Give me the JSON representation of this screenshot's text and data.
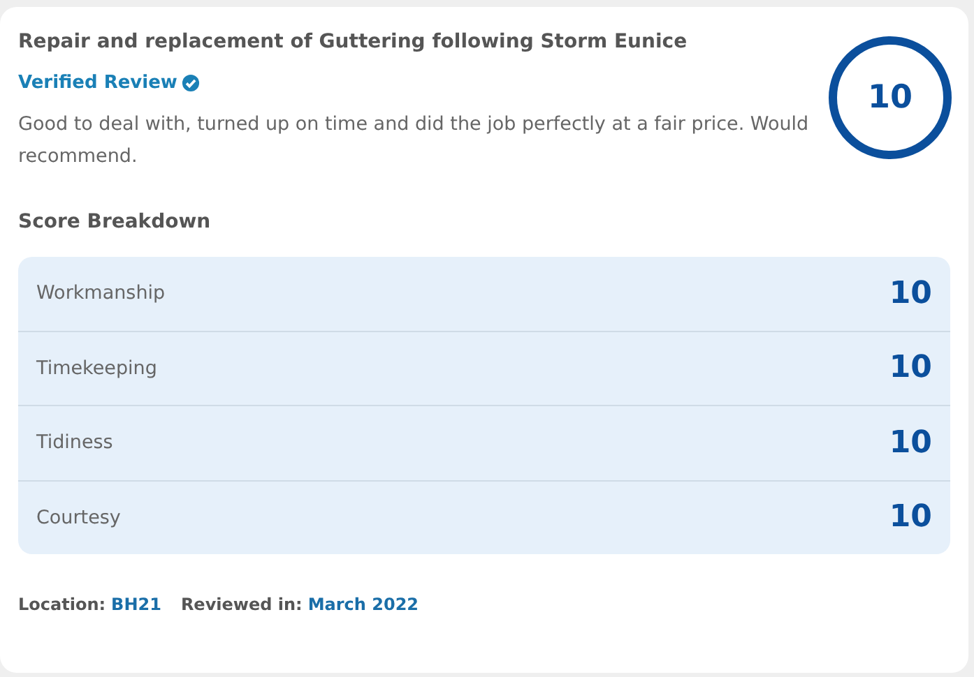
{
  "review": {
    "title": "Repair and replacement of Guttering following Storm Eunice",
    "verified_label": "Verified Review",
    "text": "Good to deal with, turned up on time and did the job perfectly at a fair price. Would recommend.",
    "score": "10"
  },
  "breakdown": {
    "heading": "Score Breakdown",
    "rows": [
      {
        "label": "Workmanship",
        "score": "10"
      },
      {
        "label": "Timekeeping",
        "score": "10"
      },
      {
        "label": "Tidiness",
        "score": "10"
      },
      {
        "label": "Courtesy",
        "score": "10"
      }
    ]
  },
  "footer": {
    "location_label": "Location:",
    "location": "BH21",
    "reviewed_label": "Reviewed in:",
    "reviewed": "March 2022"
  }
}
